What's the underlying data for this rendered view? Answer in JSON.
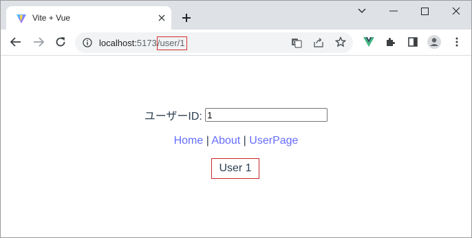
{
  "browser": {
    "tab": {
      "title": "Vite + Vue"
    },
    "url": {
      "host": "localhost:",
      "port": "5173",
      "path": "/user/1"
    }
  },
  "page": {
    "userid_label": "ユーザーID:",
    "userid_value": "1",
    "nav": {
      "home": "Home",
      "about": "About",
      "userpage": "UserPage",
      "separator": " | "
    },
    "heading": "User 1"
  },
  "colors": {
    "link": "#646cff",
    "text": "#2c3e50",
    "highlight": "#c62828"
  }
}
